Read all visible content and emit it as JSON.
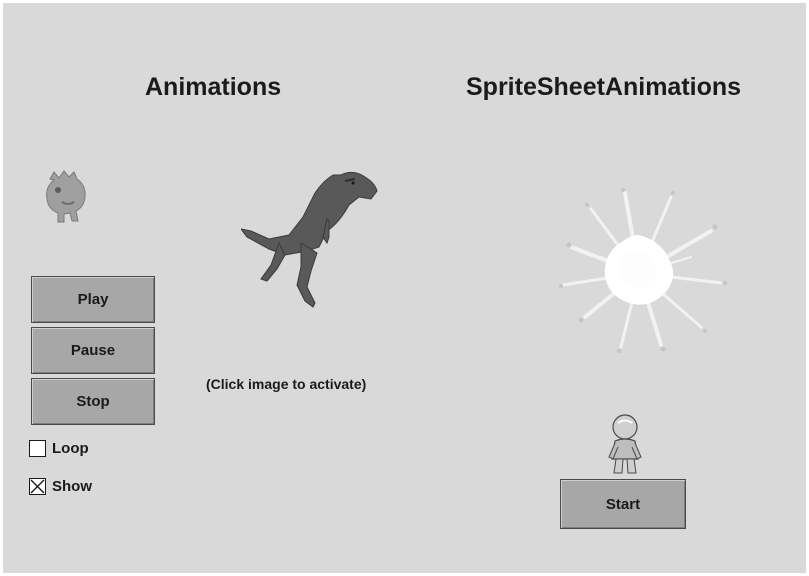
{
  "animations": {
    "title": "Animations",
    "hint": "(Click image to activate)",
    "buttons": {
      "play": "Play",
      "pause": "Pause",
      "stop": "Stop"
    },
    "checkboxes": [
      {
        "label": "Loop",
        "checked": false
      },
      {
        "label": "Show",
        "checked": true
      }
    ],
    "images": {
      "small_sprite": "monster-sprite",
      "large_sprite": "dinosaur-sprite"
    }
  },
  "sprite_sheet_animations": {
    "title": "SpriteSheetAnimations",
    "start_label": "Start",
    "images": {
      "effect": "explosion-sprite",
      "character": "character-sprite"
    }
  },
  "colors": {
    "background": "#d9d9d9",
    "button": "#a7a7a7",
    "button_border": "#4a4a4a"
  }
}
